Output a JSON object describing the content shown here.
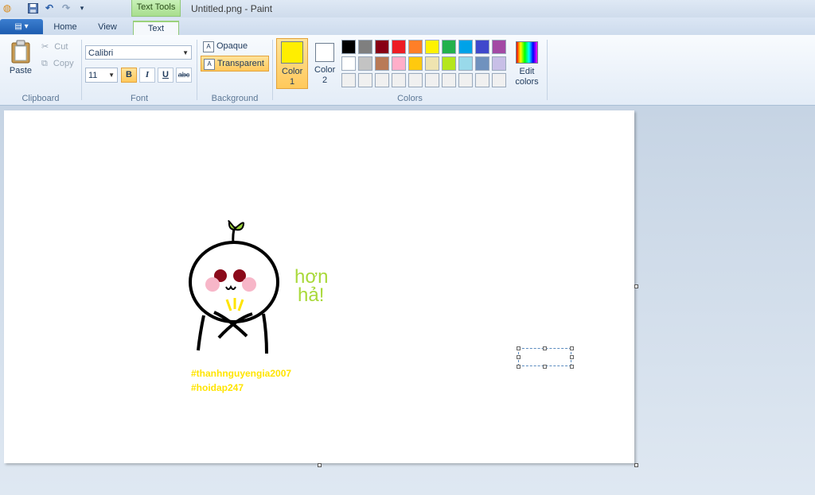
{
  "window": {
    "title": "Untitled.png - Paint",
    "context_tab": "Text Tools"
  },
  "tabs": [
    {
      "label": "Home"
    },
    {
      "label": "View"
    },
    {
      "label": "Text",
      "active": true
    }
  ],
  "clipboard": {
    "paste": "Paste",
    "cut": "Cut",
    "copy": "Copy",
    "group_label": "Clipboard"
  },
  "font": {
    "family": "Calibri",
    "size": "11",
    "group_label": "Font",
    "bold": "B",
    "italic": "I",
    "underline": "U",
    "strikethrough": "abc"
  },
  "background": {
    "opaque": "Opaque",
    "transparent": "Transparent",
    "group_label": "Background"
  },
  "colors": {
    "color1_label": "Color 1",
    "color2_label": "Color 2",
    "color1": "#ffee00",
    "color2": "#ffffff",
    "edit_label": "Edit colors",
    "group_label": "Colors",
    "palette": [
      [
        "#000000",
        "#7f7f7f",
        "#880015",
        "#ed1c24",
        "#ff7f27",
        "#fff200",
        "#22b14c",
        "#00a2e8",
        "#3f48cc",
        "#a349a4"
      ],
      [
        "#ffffff",
        "#c3c3c3",
        "#b97a57",
        "#ffaec9",
        "#ffc90e",
        "#efe4b0",
        "#b5e61d",
        "#99d9ea",
        "#7092be",
        "#c8bfe7"
      ],
      [
        "#f0f0f0",
        "#f0f0f0",
        "#f0f0f0",
        "#f0f0f0",
        "#f0f0f0",
        "#f0f0f0",
        "#f0f0f0",
        "#f0f0f0",
        "#f0f0f0",
        "#f0f0f0"
      ]
    ]
  },
  "canvas": {
    "handwriting_line1": "hơn",
    "handwriting_line2": "hả!",
    "hashtag1": "#thanhnguyengia2007",
    "hashtag2": "#hoidap247"
  }
}
